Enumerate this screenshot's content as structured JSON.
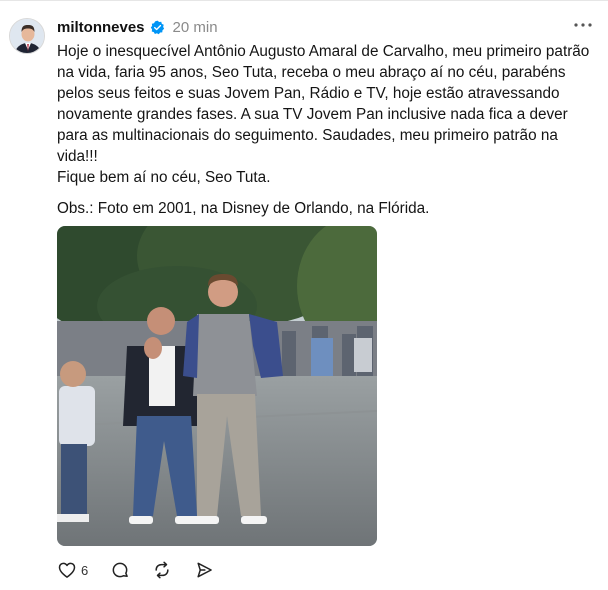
{
  "post": {
    "username": "miltonneves",
    "timestamp": "20 min",
    "text": "Hoje o inesquecível Antônio Augusto Amaral de Carvalho, meu primeiro patrão\nna vida, faria 95 anos, Seo Tuta, receba o meu abraço aí no céu, parabéns\npelos seus feitos e suas Jovem Pan, Rádio e TV, hoje estão atravessando\nnovamente grandes fases. A sua TV Jovem Pan inclusive nada fica a dever\npara as multinacionais do seguimento. Saudades, meu primeiro patrão na\nvida!!!\nFique bem aí no céu, Seo Tuta.",
    "obs": "Obs.: Foto em 2001, na Disney de Orlando, na Flórida.",
    "like_count": "6"
  },
  "icons": {
    "verified": "verified-badge-icon",
    "more": "more-horizontal-icon",
    "like": "heart-icon",
    "reply": "comment-bubble-icon",
    "repost": "repost-icon",
    "share": "send-icon"
  },
  "colors": {
    "verified": "#0095f6",
    "secondary_text": "#8a8a8a"
  }
}
